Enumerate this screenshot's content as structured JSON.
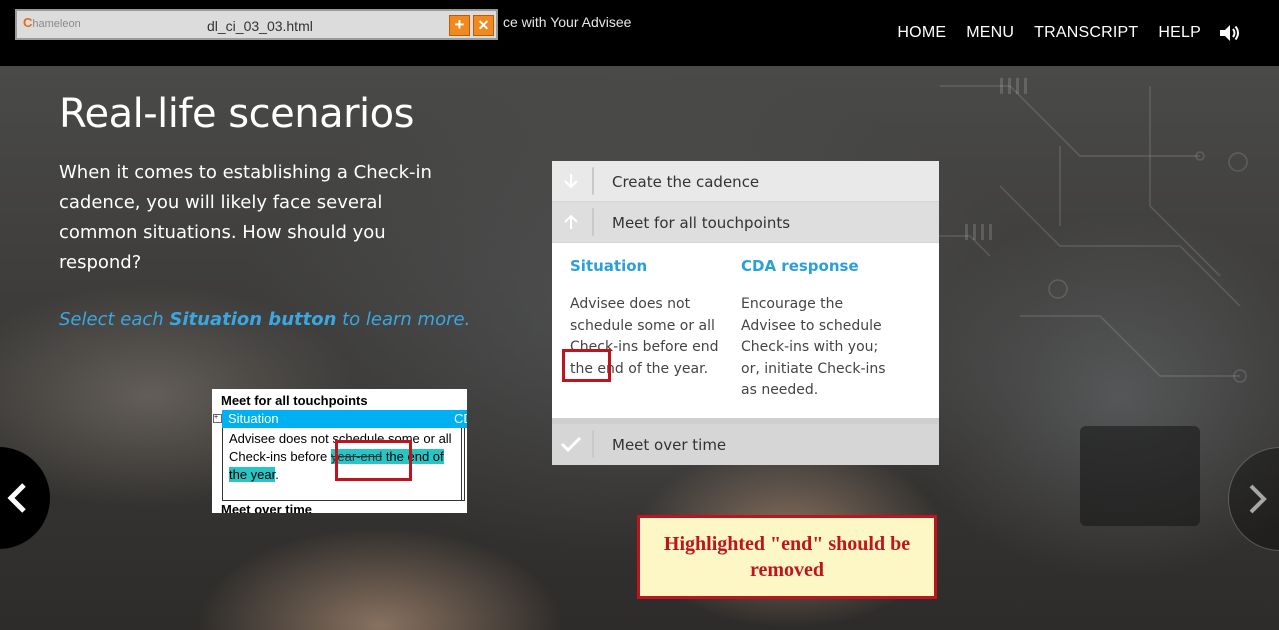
{
  "window": {
    "logo_text": "hameleon",
    "logo_letter": "C",
    "filename": "dl_ci_03_03.html",
    "add_label": "+",
    "close_label": "✕"
  },
  "header": {
    "course_title": "ce with Your Advisee",
    "nav": [
      "HOME",
      "MENU",
      "TRANSCRIPT",
      "HELP"
    ]
  },
  "main": {
    "title": "Real-life scenarios",
    "intro": "When it comes to establishing a Check-in cadence, you will likely face several common situations. How should you respond?",
    "instruction_pre": "Select each ",
    "instruction_bold": "Situation button",
    "instruction_post": " to learn more."
  },
  "accordion": {
    "items": [
      {
        "label": "Create the cadence",
        "icon": "arrow-down-icon"
      },
      {
        "label": "Meet for all touchpoints",
        "icon": "arrow-up-icon"
      },
      {
        "label": "Meet over time",
        "icon": "checkmark-icon"
      }
    ],
    "situation_header": "Situation",
    "response_header": "CDA response",
    "situation_text": "Advisee does not schedule some or all Check-ins before end the end of the year.",
    "response_text": "Encourage the Advisee to schedule Check-ins with you; or, initiate Check-ins as needed."
  },
  "doc_snippet": {
    "title": "Meet for all touchpoints",
    "col_situation": "Situation",
    "col_cut": "CD",
    "text_plain": "Advisee does not schedule some or all Check-ins before ",
    "text_struck": "year-end",
    "text_highlight": " the end of the year",
    "text_end": ".",
    "next_title": "Meet over time"
  },
  "callout": {
    "text": "Highlighted \"end\" should be removed"
  },
  "colors": {
    "accent_blue": "#2aa0d9",
    "annotation_red": "#c0141c",
    "highlight_teal": "#26c6c6",
    "callout_bg": "#fdf7c5"
  }
}
